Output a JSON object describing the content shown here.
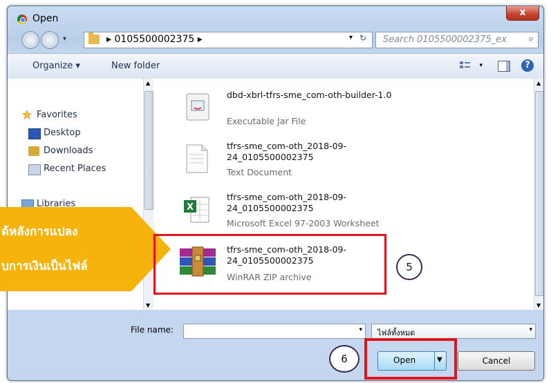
{
  "window": {
    "title": "Open",
    "close_label": "x"
  },
  "address": {
    "path": "▸ 0105500002375 ▸",
    "drop": "▾",
    "refresh": "↻"
  },
  "search": {
    "placeholder": "Search 0105500002375_ex",
    "icon": "search-icon"
  },
  "toolbar": {
    "organize": "Organize ▾",
    "new_folder": "New folder",
    "view_drop": "▾",
    "help": "?"
  },
  "nav": {
    "favorites": "Favorites",
    "desktop": "Desktop",
    "downloads": "Downloads",
    "recent": "Recent Places",
    "libraries": "Libraries"
  },
  "files": [
    {
      "name": "dbd-xbrl-tfrs-sme_com-oth-builder-1.0",
      "type": "Executable Jar File",
      "icon": "jar-file-icon"
    },
    {
      "name": "tfrs-sme_com-oth_2018-09-24_0105500002375",
      "type": "Text Document",
      "icon": "text-document-icon"
    },
    {
      "name": "tfrs-sme_com-oth_2018-09-24_0105500002375",
      "type": "Microsoft Excel 97-2003 Worksheet",
      "icon": "excel-icon"
    },
    {
      "name": "tfrs-sme_com-oth_2018-09-24_0105500002375",
      "type": "WinRAR ZIP archive",
      "icon": "winrar-icon"
    }
  ],
  "callout": {
    "line1": "ด้หลังการแปลง",
    "line2": "บการเงินเป็นไฟล์"
  },
  "steps": {
    "step5": "5",
    "step6": "6"
  },
  "bottom": {
    "filename_label": "File name:",
    "filename_value": "",
    "filetype": "ไฟล์ทั้งหมด",
    "open": "Open",
    "cancel": "Cancel"
  },
  "colors": {
    "highlight": "#e1141b",
    "callout": "#f5b30c"
  }
}
